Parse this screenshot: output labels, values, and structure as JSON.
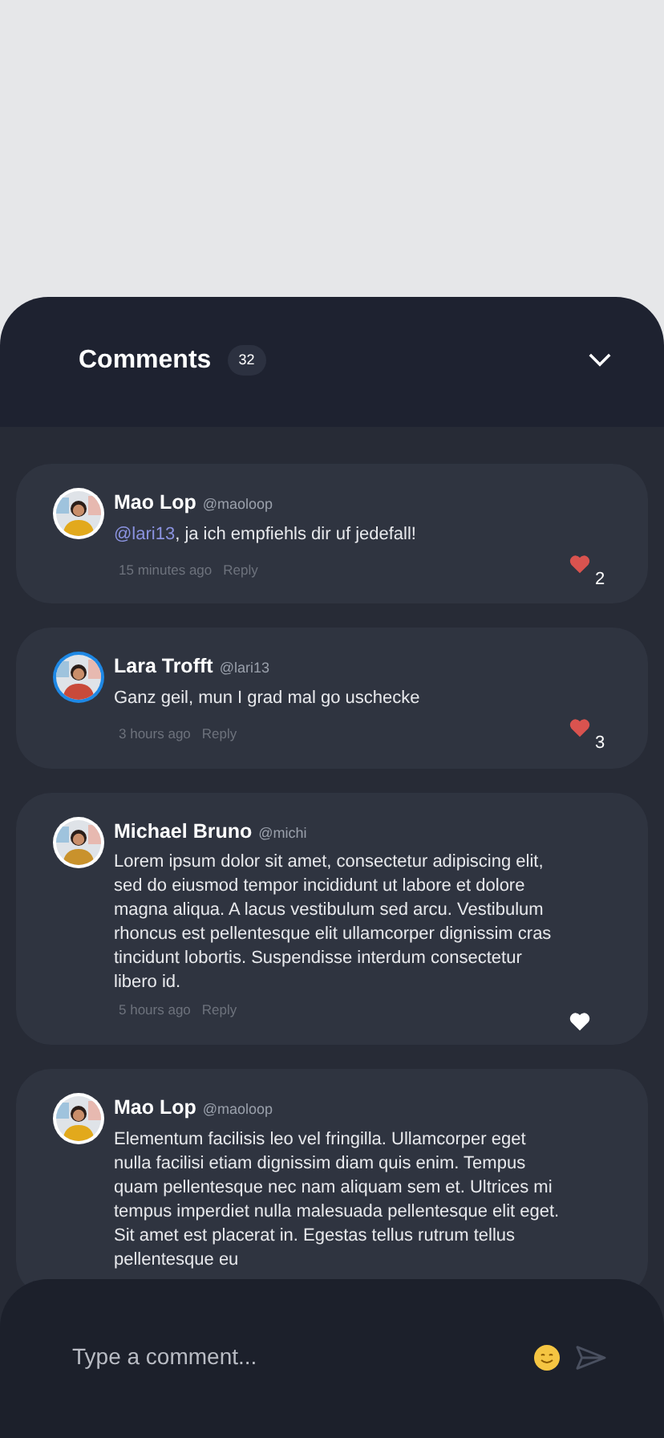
{
  "header": {
    "title": "Comments",
    "count": "32"
  },
  "comments": [
    {
      "name": "Mao Lop",
      "handle": "@maoloop",
      "mention": "@lari13",
      "text": ", ja ich empfiehls dir uf jedefall!",
      "time": "15 minutes ago",
      "reply": "Reply",
      "liked": true,
      "likes": "2",
      "ring": false,
      "color": "#e2a91c"
    },
    {
      "name": "Lara Trofft",
      "handle": "@lari13",
      "text": "Ganz geil, mun I grad mal go uschecke",
      "time": "3 hours ago",
      "reply": "Reply",
      "liked": true,
      "likes": "3",
      "ring": true,
      "color": "#c94a3a"
    },
    {
      "name": "Michael Bruno",
      "handle": "@michi",
      "text": "Lorem ipsum dolor sit amet, consectetur adipiscing elit, sed do eiusmod tempor incididunt ut labore et dolore magna aliqua. A lacus vestibulum sed arcu. Vestibulum rhoncus est pellentesque elit ullamcorper dignissim cras tincidunt lobortis. Suspendisse interdum consectetur libero id.",
      "time": "5 hours ago",
      "reply": "Reply",
      "liked": false,
      "ring": false,
      "color": "#c9922c"
    },
    {
      "name": "Mao Lop",
      "handle": "@maoloop",
      "text": "Elementum facilisis leo vel fringilla. Ullamcorper eget nulla facilisi etiam dignissim diam quis enim. Tempus quam pellentesque nec nam aliquam sem et. Ultrices mi tempus imperdiet nulla malesuada pellentesque elit eget. Sit amet est placerat in. Egestas tellus rutrum tellus pellentesque eu",
      "ring": false,
      "color": "#e2a91c"
    }
  ],
  "composer": {
    "placeholder": "Type a comment..."
  }
}
